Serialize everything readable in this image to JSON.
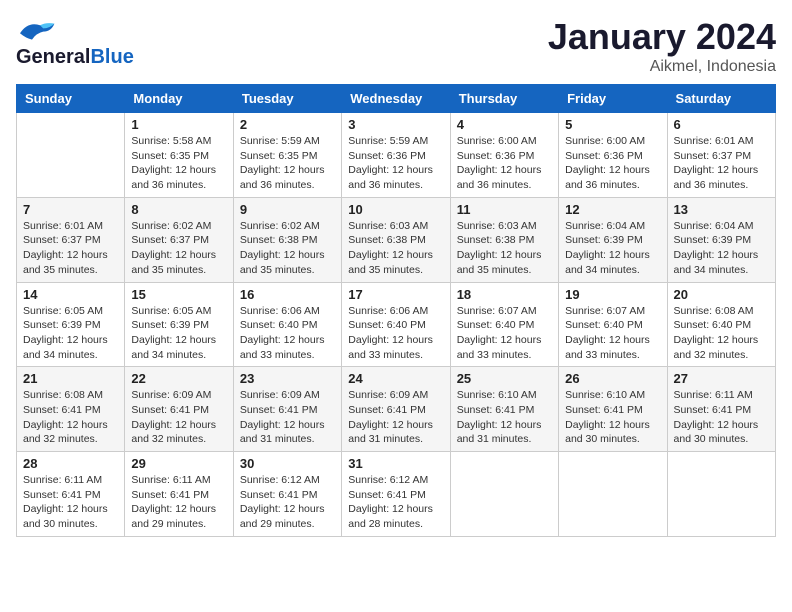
{
  "header": {
    "logo_line1": "General",
    "logo_line2": "Blue",
    "title": "January 2024",
    "subtitle": "Aikmel, Indonesia"
  },
  "days_of_week": [
    "Sunday",
    "Monday",
    "Tuesday",
    "Wednesday",
    "Thursday",
    "Friday",
    "Saturday"
  ],
  "weeks": [
    [
      {
        "day": "",
        "info": ""
      },
      {
        "day": "1",
        "info": "Sunrise: 5:58 AM\nSunset: 6:35 PM\nDaylight: 12 hours\nand 36 minutes."
      },
      {
        "day": "2",
        "info": "Sunrise: 5:59 AM\nSunset: 6:35 PM\nDaylight: 12 hours\nand 36 minutes."
      },
      {
        "day": "3",
        "info": "Sunrise: 5:59 AM\nSunset: 6:36 PM\nDaylight: 12 hours\nand 36 minutes."
      },
      {
        "day": "4",
        "info": "Sunrise: 6:00 AM\nSunset: 6:36 PM\nDaylight: 12 hours\nand 36 minutes."
      },
      {
        "day": "5",
        "info": "Sunrise: 6:00 AM\nSunset: 6:36 PM\nDaylight: 12 hours\nand 36 minutes."
      },
      {
        "day": "6",
        "info": "Sunrise: 6:01 AM\nSunset: 6:37 PM\nDaylight: 12 hours\nand 36 minutes."
      }
    ],
    [
      {
        "day": "7",
        "info": "Sunrise: 6:01 AM\nSunset: 6:37 PM\nDaylight: 12 hours\nand 35 minutes."
      },
      {
        "day": "8",
        "info": "Sunrise: 6:02 AM\nSunset: 6:37 PM\nDaylight: 12 hours\nand 35 minutes."
      },
      {
        "day": "9",
        "info": "Sunrise: 6:02 AM\nSunset: 6:38 PM\nDaylight: 12 hours\nand 35 minutes."
      },
      {
        "day": "10",
        "info": "Sunrise: 6:03 AM\nSunset: 6:38 PM\nDaylight: 12 hours\nand 35 minutes."
      },
      {
        "day": "11",
        "info": "Sunrise: 6:03 AM\nSunset: 6:38 PM\nDaylight: 12 hours\nand 35 minutes."
      },
      {
        "day": "12",
        "info": "Sunrise: 6:04 AM\nSunset: 6:39 PM\nDaylight: 12 hours\nand 34 minutes."
      },
      {
        "day": "13",
        "info": "Sunrise: 6:04 AM\nSunset: 6:39 PM\nDaylight: 12 hours\nand 34 minutes."
      }
    ],
    [
      {
        "day": "14",
        "info": "Sunrise: 6:05 AM\nSunset: 6:39 PM\nDaylight: 12 hours\nand 34 minutes."
      },
      {
        "day": "15",
        "info": "Sunrise: 6:05 AM\nSunset: 6:39 PM\nDaylight: 12 hours\nand 34 minutes."
      },
      {
        "day": "16",
        "info": "Sunrise: 6:06 AM\nSunset: 6:40 PM\nDaylight: 12 hours\nand 33 minutes."
      },
      {
        "day": "17",
        "info": "Sunrise: 6:06 AM\nSunset: 6:40 PM\nDaylight: 12 hours\nand 33 minutes."
      },
      {
        "day": "18",
        "info": "Sunrise: 6:07 AM\nSunset: 6:40 PM\nDaylight: 12 hours\nand 33 minutes."
      },
      {
        "day": "19",
        "info": "Sunrise: 6:07 AM\nSunset: 6:40 PM\nDaylight: 12 hours\nand 33 minutes."
      },
      {
        "day": "20",
        "info": "Sunrise: 6:08 AM\nSunset: 6:40 PM\nDaylight: 12 hours\nand 32 minutes."
      }
    ],
    [
      {
        "day": "21",
        "info": "Sunrise: 6:08 AM\nSunset: 6:41 PM\nDaylight: 12 hours\nand 32 minutes."
      },
      {
        "day": "22",
        "info": "Sunrise: 6:09 AM\nSunset: 6:41 PM\nDaylight: 12 hours\nand 32 minutes."
      },
      {
        "day": "23",
        "info": "Sunrise: 6:09 AM\nSunset: 6:41 PM\nDaylight: 12 hours\nand 31 minutes."
      },
      {
        "day": "24",
        "info": "Sunrise: 6:09 AM\nSunset: 6:41 PM\nDaylight: 12 hours\nand 31 minutes."
      },
      {
        "day": "25",
        "info": "Sunrise: 6:10 AM\nSunset: 6:41 PM\nDaylight: 12 hours\nand 31 minutes."
      },
      {
        "day": "26",
        "info": "Sunrise: 6:10 AM\nSunset: 6:41 PM\nDaylight: 12 hours\nand 30 minutes."
      },
      {
        "day": "27",
        "info": "Sunrise: 6:11 AM\nSunset: 6:41 PM\nDaylight: 12 hours\nand 30 minutes."
      }
    ],
    [
      {
        "day": "28",
        "info": "Sunrise: 6:11 AM\nSunset: 6:41 PM\nDaylight: 12 hours\nand 30 minutes."
      },
      {
        "day": "29",
        "info": "Sunrise: 6:11 AM\nSunset: 6:41 PM\nDaylight: 12 hours\nand 29 minutes."
      },
      {
        "day": "30",
        "info": "Sunrise: 6:12 AM\nSunset: 6:41 PM\nDaylight: 12 hours\nand 29 minutes."
      },
      {
        "day": "31",
        "info": "Sunrise: 6:12 AM\nSunset: 6:41 PM\nDaylight: 12 hours\nand 28 minutes."
      },
      {
        "day": "",
        "info": ""
      },
      {
        "day": "",
        "info": ""
      },
      {
        "day": "",
        "info": ""
      }
    ]
  ]
}
